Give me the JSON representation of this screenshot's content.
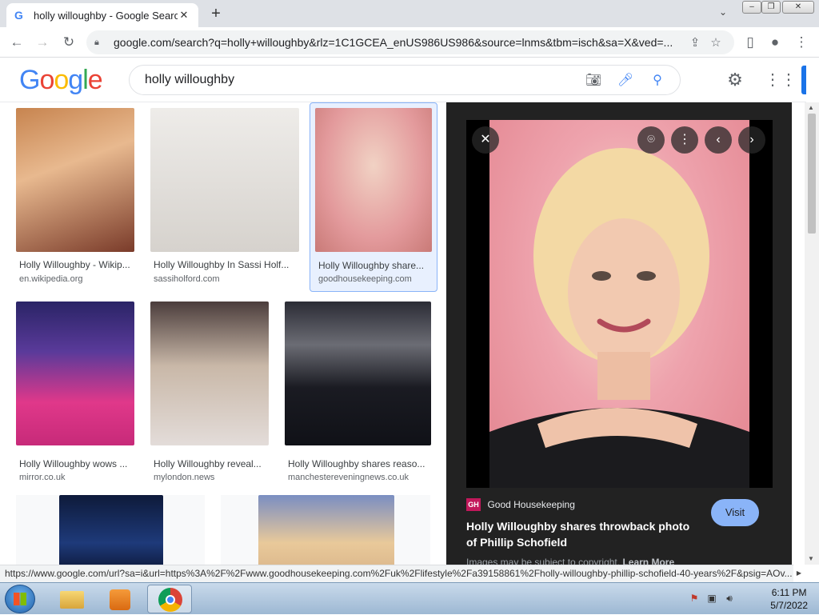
{
  "browser": {
    "tab_title": "holly willoughby - Google Search",
    "tab_favicon": "G",
    "url": "google.com/search?q=holly+willoughby&rlz=1C1GCEA_enUS986US986&source=lnms&tbm=isch&sa=X&ved=...",
    "status_url": "https://www.google.com/url?sa=i&url=https%3A%2F%2Fwww.goodhousekeeping.com%2Fuk%2Flifestyle%2Fa39158861%2Fholly-willoughby-phillip-schofield-40-years%2F&psig=AOv..."
  },
  "google": {
    "logo": "Google",
    "query": "holly willoughby"
  },
  "results": [
    {
      "title": "Holly Willoughby - Wikip...",
      "source": "en.wikipedia.org",
      "colors": [
        "#7a3b2a",
        "#c78c5e"
      ]
    },
    {
      "title": "Holly Willoughby In Sassi Holf...",
      "source": "sassiholford.com",
      "colors": [
        "#e8e6e3",
        "#cfcac4"
      ]
    },
    {
      "title": "Holly Willoughby share...",
      "source": "goodhousekeeping.com",
      "colors": [
        "#e6a3a6",
        "#d98a86"
      ]
    },
    {
      "title": "Holly Willoughby wows ...",
      "source": "mirror.co.uk",
      "colors": [
        "#3a2a6e",
        "#e0388a"
      ]
    },
    {
      "title": "Holly Willoughby reveal...",
      "source": "mylondon.news",
      "colors": [
        "#5b4a48",
        "#d9d1cf"
      ]
    },
    {
      "title": "Holly Willoughby shares reaso...",
      "source": "manchestereveningnews.co.uk",
      "colors": [
        "#1e1f26",
        "#4a4b55"
      ]
    }
  ],
  "preview": {
    "site_logo": "GH",
    "site_name": "Good Housekeeping",
    "headline": "Holly Willoughby shares throwback photo of Phillip Schofield",
    "copyright": "Images may be subject to copyright.",
    "learn_more": "Learn More",
    "visit_label": "Visit"
  },
  "taskbar": {
    "time": "6:11 PM",
    "date": "5/7/2022"
  }
}
